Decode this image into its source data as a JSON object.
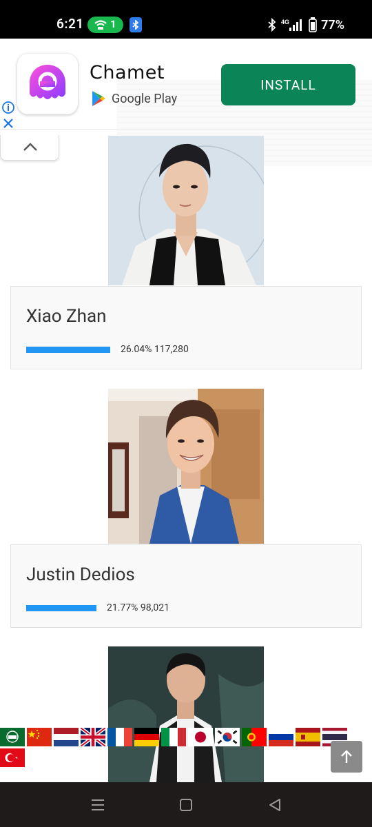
{
  "status_bar": {
    "time": "6:21",
    "hotspot_count": "1",
    "network": "4G",
    "battery": "77%"
  },
  "ad": {
    "app_name": "Chamet",
    "store_label": "Google Play",
    "install_label": "INSTALL",
    "icon": "chamet-app-icon"
  },
  "entries": [
    {
      "name": "Xiao Zhan",
      "percent_label": "26.04% 117,280",
      "percent": 26.04,
      "votes": "117,280"
    },
    {
      "name": "Justin Dedios",
      "percent_label": "21.77% 98,021",
      "percent": 21.77,
      "votes": "98,021"
    }
  ],
  "languages": [
    "arabic",
    "chinese",
    "dutch",
    "english",
    "french",
    "german",
    "italian",
    "japanese",
    "korean",
    "portuguese",
    "russian",
    "spanish",
    "thai",
    "turkish"
  ],
  "colors": {
    "progress_bar": "#2196f3",
    "install_button": "#0b8457",
    "navbar": "#201b1b"
  }
}
